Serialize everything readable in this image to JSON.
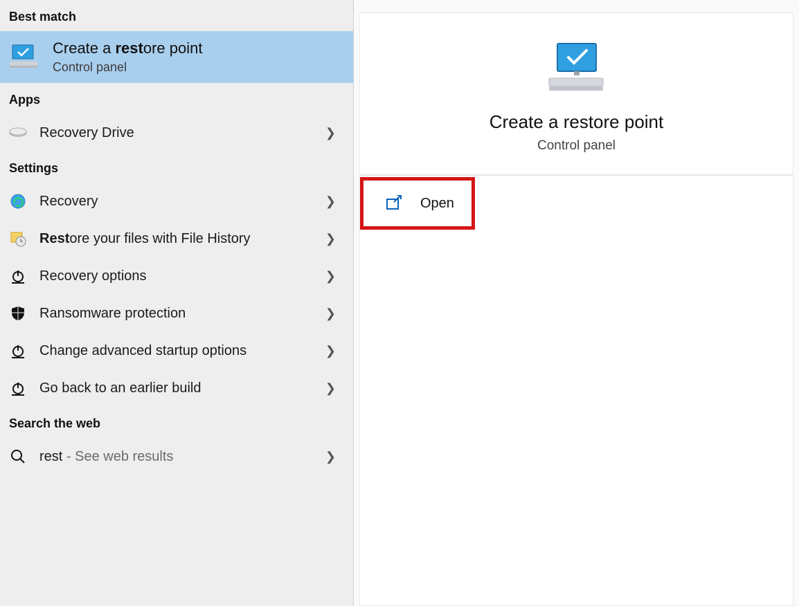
{
  "sections": {
    "best_match_header": "Best match",
    "apps_header": "Apps",
    "settings_header": "Settings",
    "web_header": "Search the web"
  },
  "best_match": {
    "title_prefix": "Create a ",
    "title_bold": "rest",
    "title_suffix": "ore point",
    "subtitle": "Control panel",
    "icon": "monitor-check-icon"
  },
  "apps": [
    {
      "label": "Recovery Drive",
      "icon": "drive-icon"
    }
  ],
  "settings": [
    {
      "label": "Recovery",
      "icon": "recovery-globe-icon"
    },
    {
      "label_bold": "Rest",
      "label_rest": "ore your files with File History",
      "icon": "file-history-icon"
    },
    {
      "label": "Recovery options",
      "icon": "power-icon"
    },
    {
      "label": "Ransomware protection",
      "icon": "shield-icon"
    },
    {
      "label": "Change advanced startup options",
      "icon": "power-icon"
    },
    {
      "label": "Go back to an earlier build",
      "icon": "power-icon"
    }
  ],
  "web": {
    "query": "rest",
    "hint": " - See web results",
    "icon": "search-icon"
  },
  "preview": {
    "title": "Create a restore point",
    "subtitle": "Control panel",
    "icon": "monitor-check-large-icon",
    "action_label": "Open",
    "action_icon": "open-external-icon"
  }
}
